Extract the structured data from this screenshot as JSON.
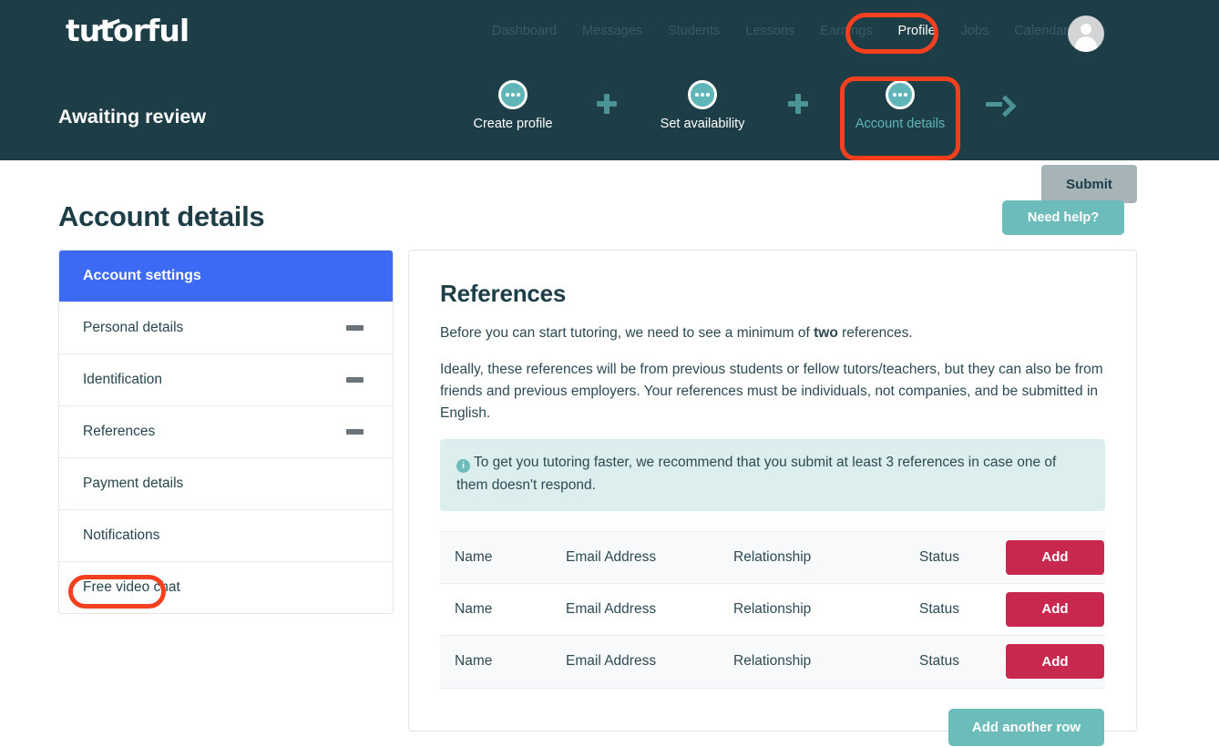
{
  "brand": {
    "logo_text": "tutorful",
    "dark": "#1d3d47",
    "teal": "#6cbcbb",
    "blue": "#3d6af5",
    "crimson": "#c8284e",
    "highlight": "#f5401f"
  },
  "nav": {
    "items": [
      {
        "label": "Dashboard",
        "active": false
      },
      {
        "label": "Messages",
        "active": false
      },
      {
        "label": "Students",
        "active": false
      },
      {
        "label": "Lessons",
        "active": false
      },
      {
        "label": "Earnings",
        "active": false
      },
      {
        "label": "Profile",
        "active": true
      },
      {
        "label": "Jobs",
        "active": false
      },
      {
        "label": "Calendar",
        "active": false
      }
    ]
  },
  "progress": {
    "status_label": "Awaiting review",
    "steps": [
      {
        "label": "Create profile",
        "icon": "ellipsis-icon",
        "active": false
      },
      {
        "label": "Set availability",
        "icon": "ellipsis-icon",
        "active": false
      },
      {
        "label": "Account details",
        "icon": "ellipsis-icon",
        "active": true
      }
    ],
    "separator_icon": "plus-icon",
    "arrow_icon": "arrow-right-icon",
    "submit_label": "Submit"
  },
  "page": {
    "title": "Account details",
    "need_help_label": "Need help?"
  },
  "sidebar": {
    "header": "Account settings",
    "items": [
      {
        "label": "Personal details",
        "status_icon": "minus-icon",
        "has_icon": true
      },
      {
        "label": "Identification",
        "status_icon": "minus-icon",
        "has_icon": true
      },
      {
        "label": "References",
        "status_icon": "minus-icon",
        "has_icon": true
      },
      {
        "label": "Payment details",
        "status_icon": "",
        "has_icon": false
      },
      {
        "label": "Notifications",
        "status_icon": "",
        "has_icon": false
      },
      {
        "label": "Free video chat",
        "status_icon": "",
        "has_icon": false
      }
    ]
  },
  "main": {
    "title": "References",
    "intro_before": "Before you can start tutoring, we need to see a minimum of ",
    "intro_bold": "two",
    "intro_after": " references.",
    "body": "Ideally, these references will be from previous students or fellow tutors/teachers, but they can also be from friends and previous employers. Your references must be individuals, not companies, and be submitted in English.",
    "alert": {
      "icon": "info-icon",
      "icon_glyph": "i",
      "text": "To get you tutoring faster, we recommend that you submit at least 3 references in case one of them doesn't respond."
    },
    "table": {
      "rows": [
        {
          "name": "Name",
          "email": "Email Address",
          "relationship": "Relationship",
          "status": "Status",
          "action": "Add"
        },
        {
          "name": "Name",
          "email": "Email Address",
          "relationship": "Relationship",
          "status": "Status",
          "action": "Add"
        },
        {
          "name": "Name",
          "email": "Email Address",
          "relationship": "Relationship",
          "status": "Status",
          "action": "Add"
        }
      ]
    },
    "add_row_label": "Add another row"
  }
}
